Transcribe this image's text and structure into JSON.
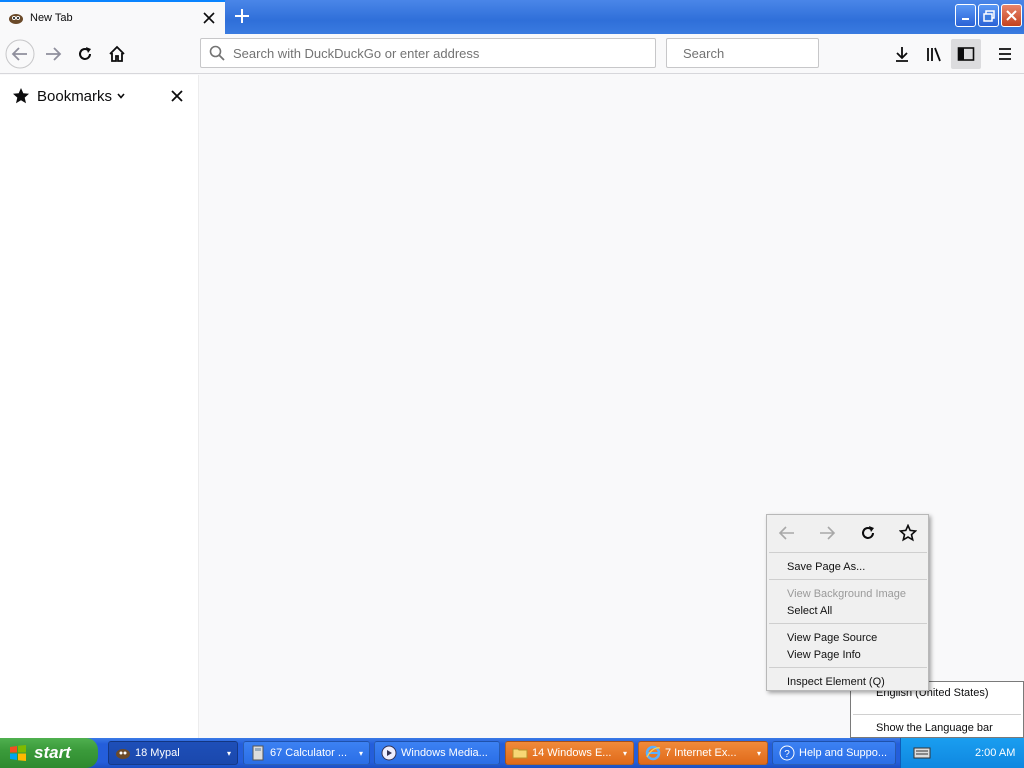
{
  "tab": {
    "title": "New Tab"
  },
  "urlbar": {
    "placeholder": "Search with DuckDuckGo or enter address"
  },
  "searchbar": {
    "placeholder": "Search"
  },
  "sidebar": {
    "title": "Bookmarks"
  },
  "context_menu": {
    "items": [
      {
        "label": "Save Page As...",
        "disabled": false
      },
      {
        "label": "View Background Image",
        "disabled": true
      },
      {
        "label": "Select All",
        "disabled": false
      },
      {
        "label": "View Page Source",
        "disabled": false
      },
      {
        "label": "View Page Info",
        "disabled": false
      },
      {
        "label": "Inspect Element (Q)",
        "disabled": false
      }
    ]
  },
  "language_menu": {
    "items": [
      {
        "label": "English (United States)"
      },
      {
        "label": "Show the Language bar"
      }
    ]
  },
  "taskbar": {
    "start_label": "start",
    "tasks": [
      {
        "label": "18 Mypal",
        "icon": "mypal-icon"
      },
      {
        "label": "67 Calculator ...",
        "icon": "calculator-icon"
      },
      {
        "label": "Windows Media...",
        "icon": "media-player-icon"
      },
      {
        "label": "14 Windows E...",
        "icon": "folder-icon"
      },
      {
        "label": "7 Internet Ex...",
        "icon": "ie-icon"
      },
      {
        "label": "Help and Suppo...",
        "icon": "help-icon"
      }
    ],
    "clock": "2:00 AM"
  },
  "colors": {
    "accent": "#0a84ff",
    "taskbar": "#245edb",
    "start": "#3b9b3b",
    "orange_task": "#e06a1a"
  }
}
